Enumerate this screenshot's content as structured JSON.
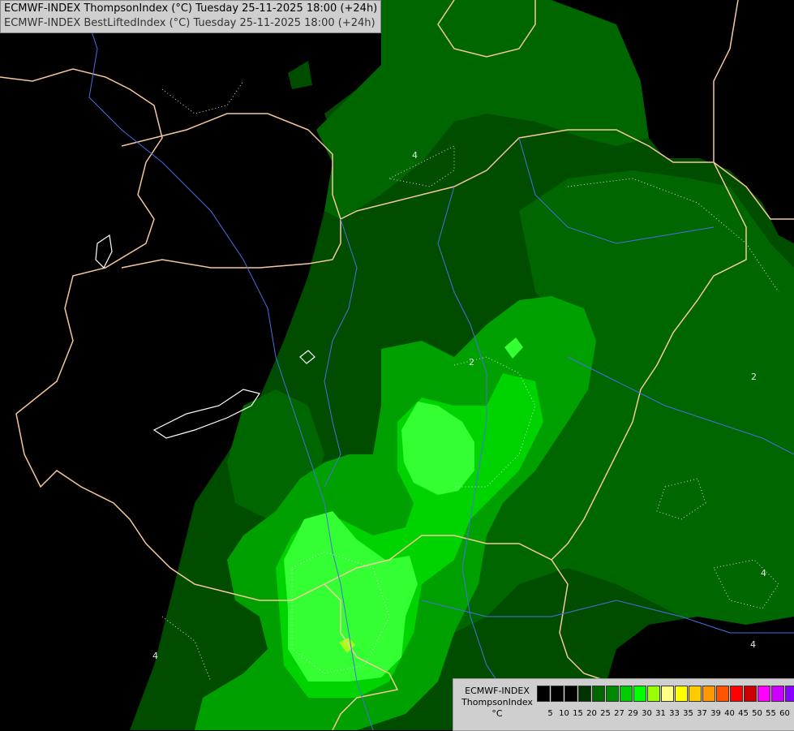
{
  "header": {
    "line1": "ECMWF-INDEX ThompsonIndex (°C) Tuesday 25-11-2025 18:00 (+24h)",
    "line2": "ECMWF-INDEX BestLiftedIndex (°C) Tuesday 25-11-2025 18:00 (+24h)"
  },
  "legend": {
    "line1": "ECMWF-INDEX",
    "line2": "ThompsonIndex",
    "line3": "°C",
    "levels": [
      "5",
      "10",
      "15",
      "20",
      "25",
      "27",
      "29",
      "30",
      "31",
      "33",
      "35",
      "37",
      "39",
      "40",
      "45",
      "50",
      "55",
      "60"
    ],
    "colors": [
      "#000000",
      "#000000",
      "#000000",
      "#003300",
      "#006600",
      "#008800",
      "#00cc00",
      "#00ff00",
      "#99ff00",
      "#ffff88",
      "#ffff00",
      "#ffcc00",
      "#ff9900",
      "#ff5500",
      "#ff0000",
      "#cc0000",
      "#ff00ff",
      "#cc00ff",
      "#8800ff",
      "#4400ff",
      "#0000ff"
    ]
  },
  "map_colors": {
    "background": "#000000",
    "level_20": "#004d00",
    "level_25": "#006600",
    "level_27": "#00a000",
    "level_29": "#00d400",
    "level_30": "#33ff33",
    "level_31": "#a6ff1a",
    "border": "#f5c89a",
    "river": "#4a6ee0",
    "isoline": "#dcdcdc"
  },
  "isoline_labels": [
    "4",
    "2",
    "2",
    "4",
    "4",
    "4"
  ]
}
